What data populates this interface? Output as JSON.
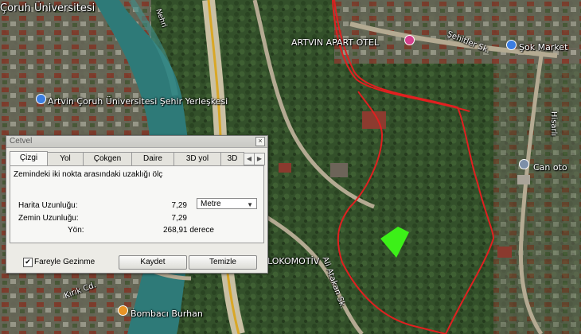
{
  "map": {
    "labels": {
      "university_top": "Çoruh Üniversitesi",
      "river": "Nehri",
      "hotel": "ARTVIN APART OTEL",
      "street_top": "Şehitler Sk.",
      "market": "Şok Market",
      "campus": "Artvin Çoruh Üniversitesi Şehir Yerleşkesi",
      "street_right": "Hisarlı",
      "can_oto": "Can oto",
      "lokomotiv": "LOKOMOTİV",
      "street_bottom": "Ali Atakan Sk.",
      "street_left": "Kırık Cd.",
      "bombaci": "Bombacı Burhan"
    },
    "colors": {
      "boundary": "#e02020",
      "marker": "#3cf018"
    }
  },
  "dialog": {
    "title": "Cetvel",
    "close": "×",
    "tabs": [
      "Çizgi",
      "Yol",
      "Çokgen",
      "Daire",
      "3D yol",
      "3D"
    ],
    "active_tab": "Çizgi",
    "description": "Zemindeki iki nokta arasındaki uzaklığı ölç",
    "map_length_label": "Harita Uzunluğu:",
    "map_length_value": "7,29",
    "unit": "Metre",
    "ground_length_label": "Zemin Uzunluğu:",
    "ground_length_value": "7,29",
    "heading_label": "Yön:",
    "heading_value": "268,91 derece",
    "mouse_nav_checked": true,
    "mouse_nav_label": "Fareyle Gezinme",
    "save_label": "Kaydet",
    "clear_label": "Temizle"
  }
}
